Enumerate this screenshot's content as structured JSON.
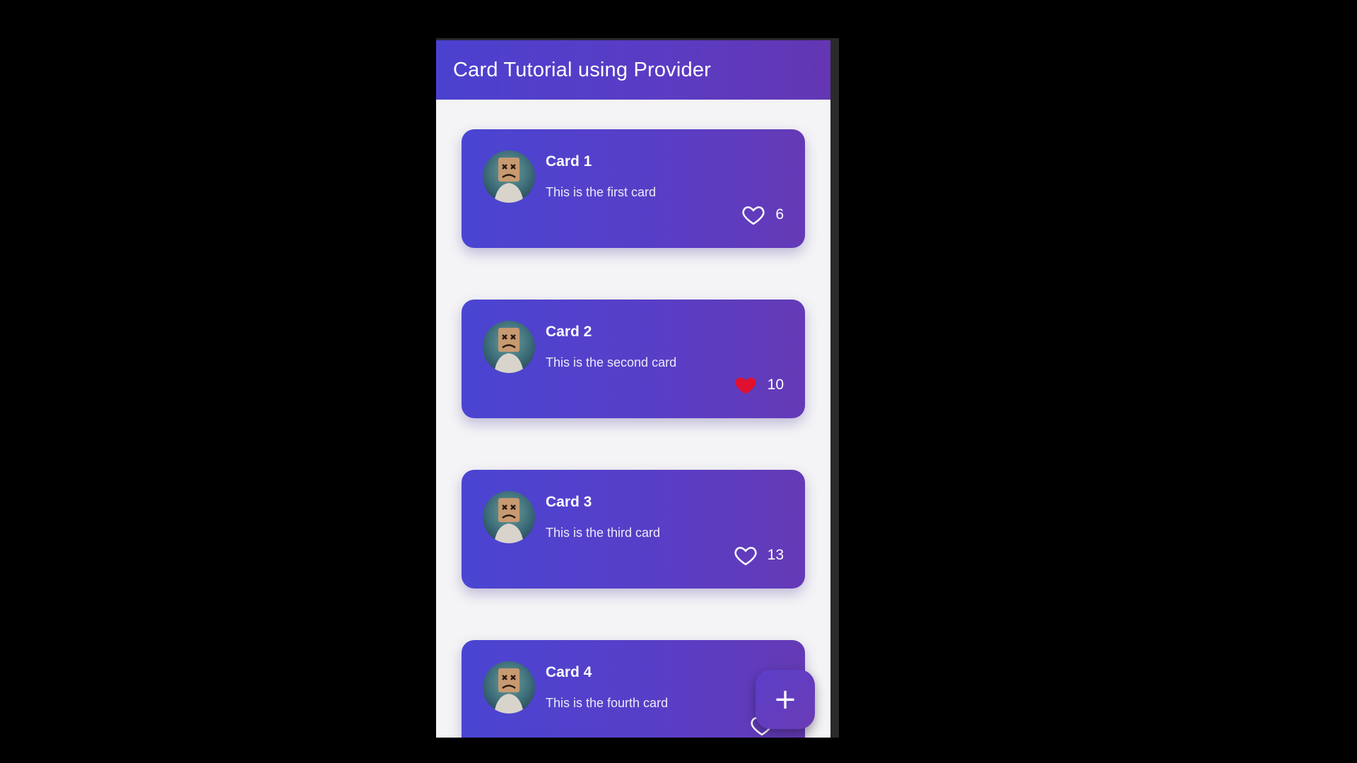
{
  "appbar": {
    "title": "Card Tutorial using Provider"
  },
  "cards": [
    {
      "title": "Card 1",
      "subtitle": "This is the first card",
      "likes": "6",
      "liked": false
    },
    {
      "title": "Card 2",
      "subtitle": "This is the second card",
      "likes": "10",
      "liked": true
    },
    {
      "title": "Card 3",
      "subtitle": "This is the third card",
      "likes": "13",
      "liked": false
    },
    {
      "title": "Card 4",
      "subtitle": "This is the fourth card",
      "likes": "",
      "liked": false
    }
  ],
  "fab": {
    "icon": "plus-icon",
    "label": "+"
  },
  "colors": {
    "accent": "#583ec7",
    "liked_heart": "#e0102e",
    "background": "#f4f4f6"
  }
}
